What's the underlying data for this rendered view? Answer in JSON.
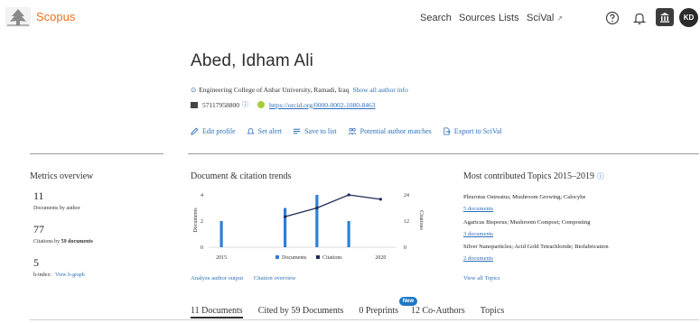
{
  "header": {
    "brand": "Scopus",
    "nav": {
      "search": "Search",
      "sources": "Sources",
      "lists": "Lists",
      "scival": "SciVal",
      "scival_ext": "↗"
    },
    "icons": [
      "help-icon",
      "bell-icon",
      "institution-icon"
    ],
    "avatar_initials": "KD",
    "brand_color": "#e9711c"
  },
  "profile": {
    "name": "Abed, Idham Ali",
    "affiliation": "Engineering College of Anbar University, Ramadi, Iraq",
    "show_all_author_info": "Show all author info",
    "scopus_id": "57117958800",
    "orcid": "https://orcid.org/0000-0002-1080-8463"
  },
  "actions": {
    "edit_profile": "Edit profile",
    "set_alert": "Set alert",
    "save_to_list": "Save to list",
    "potential_matches": "Potential author matches",
    "export_scival": "Export to SciVal"
  },
  "metrics": {
    "title": "Metrics overview",
    "documents_value": "11",
    "documents_label": "Documents by author",
    "citations_value": "77",
    "citations_label_prefix": "Citations by",
    "citations_label_bold": "59 documents",
    "hindex_value": "5",
    "hindex_label": "h-index:",
    "hgraph_link": "View h-graph"
  },
  "trends": {
    "title": "Document & citation trends",
    "analyze_link": "Analyze author output",
    "citation_overview_link": "Citation overview"
  },
  "chart_data": {
    "type": "bar",
    "title": "Document & citation trends",
    "x_tick_labels": [
      "2015",
      "2020"
    ],
    "ylabel_left": "Documents",
    "ylabel_right": "Citations",
    "ylim_left": [
      0,
      4
    ],
    "ylim_right": [
      0,
      24
    ],
    "yticks_left": [
      "4",
      "2",
      "0"
    ],
    "yticks_right": [
      "24",
      "12",
      "0"
    ],
    "series": [
      {
        "name": "Documents",
        "type": "bar",
        "color": "#2e7fd6",
        "points": [
          {
            "year": 2015,
            "value": 2
          },
          {
            "year": 2017,
            "value": 3
          },
          {
            "year": 2018,
            "value": 4
          },
          {
            "year": 2019,
            "value": 2
          }
        ]
      },
      {
        "name": "Citations",
        "type": "line",
        "color": "#1f2a5c",
        "points": [
          {
            "year": 2017,
            "value": 14
          },
          {
            "year": 2018,
            "value": 18
          },
          {
            "year": 2019,
            "value": 24
          },
          {
            "year": 2020,
            "value": 22
          }
        ]
      }
    ],
    "xlim": [
      2014.6,
      2020.5
    ],
    "legend": "bottom-center"
  },
  "topics": {
    "title": "Most contributed Topics 2015–2019",
    "items": [
      {
        "label": "Pleurotus Ostreatus; Mushroom Growing; Calocybe",
        "docs": "5 documents"
      },
      {
        "label": "Agaricus Bisporus; Mushroom Compost; Composting",
        "docs": "3 documents"
      },
      {
        "label": "Silver Nanoparticles; Acid Gold Tetrachloride; Biofabrication",
        "docs": "2 documents"
      }
    ],
    "view_all": "View all Topics"
  },
  "tabs": {
    "documents": "11 Documents",
    "cited_by": "Cited by 59 Documents",
    "preprints": "0 Preprints",
    "new_badge": "New",
    "coauthors": "12 Co-Authors",
    "topics": "Topics"
  }
}
